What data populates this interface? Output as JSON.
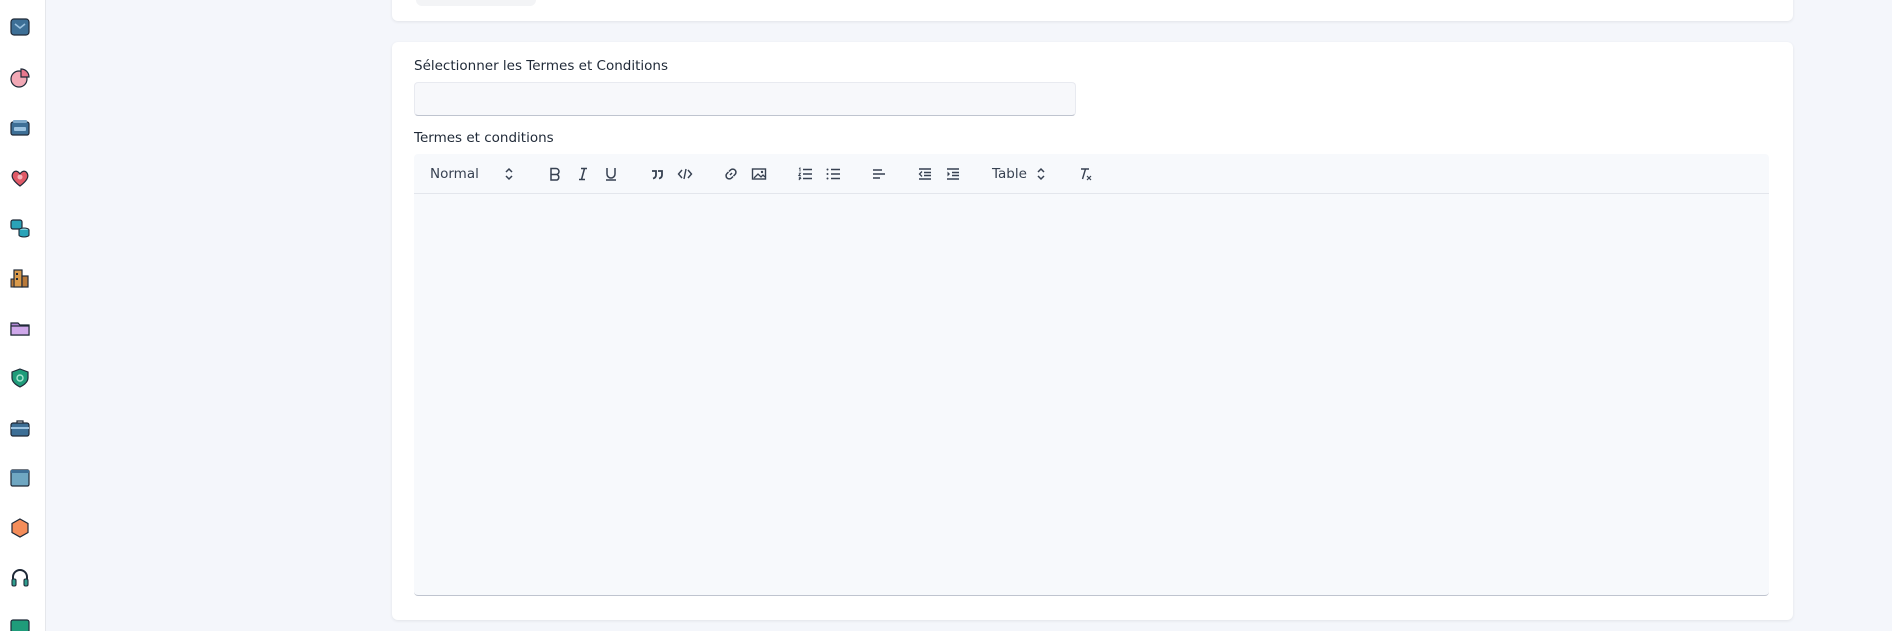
{
  "sidebar": {
    "icons": [
      {
        "name": "inbox-icon",
        "color": "#3d6f96"
      },
      {
        "name": "pie-chart-icon",
        "color": "#e8788e"
      },
      {
        "name": "card-stack-icon",
        "color": "#3d6f96"
      },
      {
        "name": "support-heart-icon",
        "color": "#e05a67"
      },
      {
        "name": "database-icon",
        "color": "#2aa3b8"
      },
      {
        "name": "buildings-icon",
        "color": "#d99a4b"
      },
      {
        "name": "folder-icon",
        "color": "#b58ad8"
      },
      {
        "name": "shield-icon",
        "color": "#1f9c7a"
      },
      {
        "name": "briefcase-icon",
        "color": "#3d6f96"
      },
      {
        "name": "browser-window-icon",
        "color": "#6fa7c2"
      },
      {
        "name": "hexagon-icon",
        "color": "#f48d5a"
      },
      {
        "name": "headset-icon",
        "color": "#2f9e8e"
      },
      {
        "name": "monitor-icon",
        "color": "#1f9c7a"
      }
    ]
  },
  "form": {
    "select_terms_label": "Sélectionner les Termes et Conditions",
    "select_terms_value": "",
    "terms_label": "Termes et conditions"
  },
  "toolbar": {
    "heading_select": "Normal",
    "table_select": "Table"
  }
}
